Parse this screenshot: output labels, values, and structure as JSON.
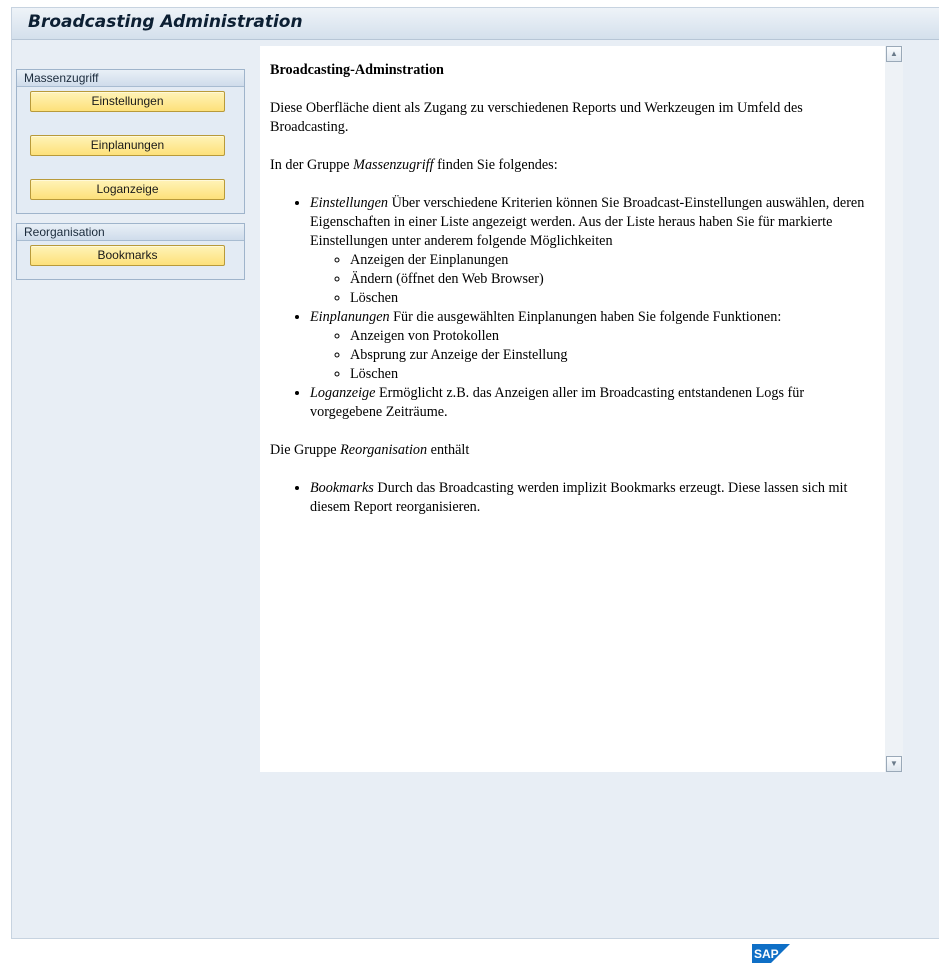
{
  "app": {
    "title": "Broadcasting Administration"
  },
  "groups": [
    {
      "header": "Massenzugriff",
      "buttons": [
        "Einstellungen",
        "Einplanungen",
        "Loganzeige"
      ]
    },
    {
      "header": "Reorganisation",
      "buttons": [
        "Bookmarks"
      ]
    }
  ],
  "doc": {
    "heading": "Broadcasting-Adminstration",
    "intro": "Diese Oberfläche dient als Zugang zu verschiedenen Reports und Werkzeugen im Umfeld des Broadcasting.",
    "group1_pre": "In der Gruppe ",
    "group1_name": "Massenzugriff",
    "group1_post": " finden Sie folgendes:",
    "items": [
      {
        "term": "Einstellungen",
        "text": " Über verschiedene Kriterien können Sie Broadcast-Einstellungen auswählen, deren Eigenschaften in einer Liste angezeigt werden. Aus der Liste heraus haben Sie für markierte Einstellungen unter anderem folgende Möglichkeiten",
        "sub": [
          "Anzeigen der Einplanungen",
          "Ändern (öffnet den Web Browser)",
          "Löschen"
        ]
      },
      {
        "term": "Einplanungen",
        "text": " Für die ausgewählten Einplanungen haben Sie folgende Funktionen:",
        "sub": [
          "Anzeigen von Protokollen",
          "Absprung zur Anzeige der Einstellung",
          "Löschen"
        ]
      },
      {
        "term": "Loganzeige",
        "text": " Ermöglicht z.B. das Anzeigen aller im Broadcasting entstandenen Logs für vorgegebene Zeiträume."
      }
    ],
    "group2_pre": "Die Gruppe ",
    "group2_name": "Reorganisation",
    "group2_post": " enthält",
    "bookmark_term": "Bookmarks",
    "bookmark_text": " Durch das Broadcasting werden implizit Bookmarks erzeugt. Diese lassen sich mit diesem Report reorganisieren."
  },
  "icons": {
    "scroll_up": "scroll-up-arrow-icon",
    "scroll_down": "scroll-down-arrow-icon",
    "logo": "sap-logo-icon"
  },
  "colors": {
    "button_fill": "#fde17a",
    "logo_blue": "#0f6fc6"
  },
  "footer": {
    "logo_text": "SAP"
  }
}
